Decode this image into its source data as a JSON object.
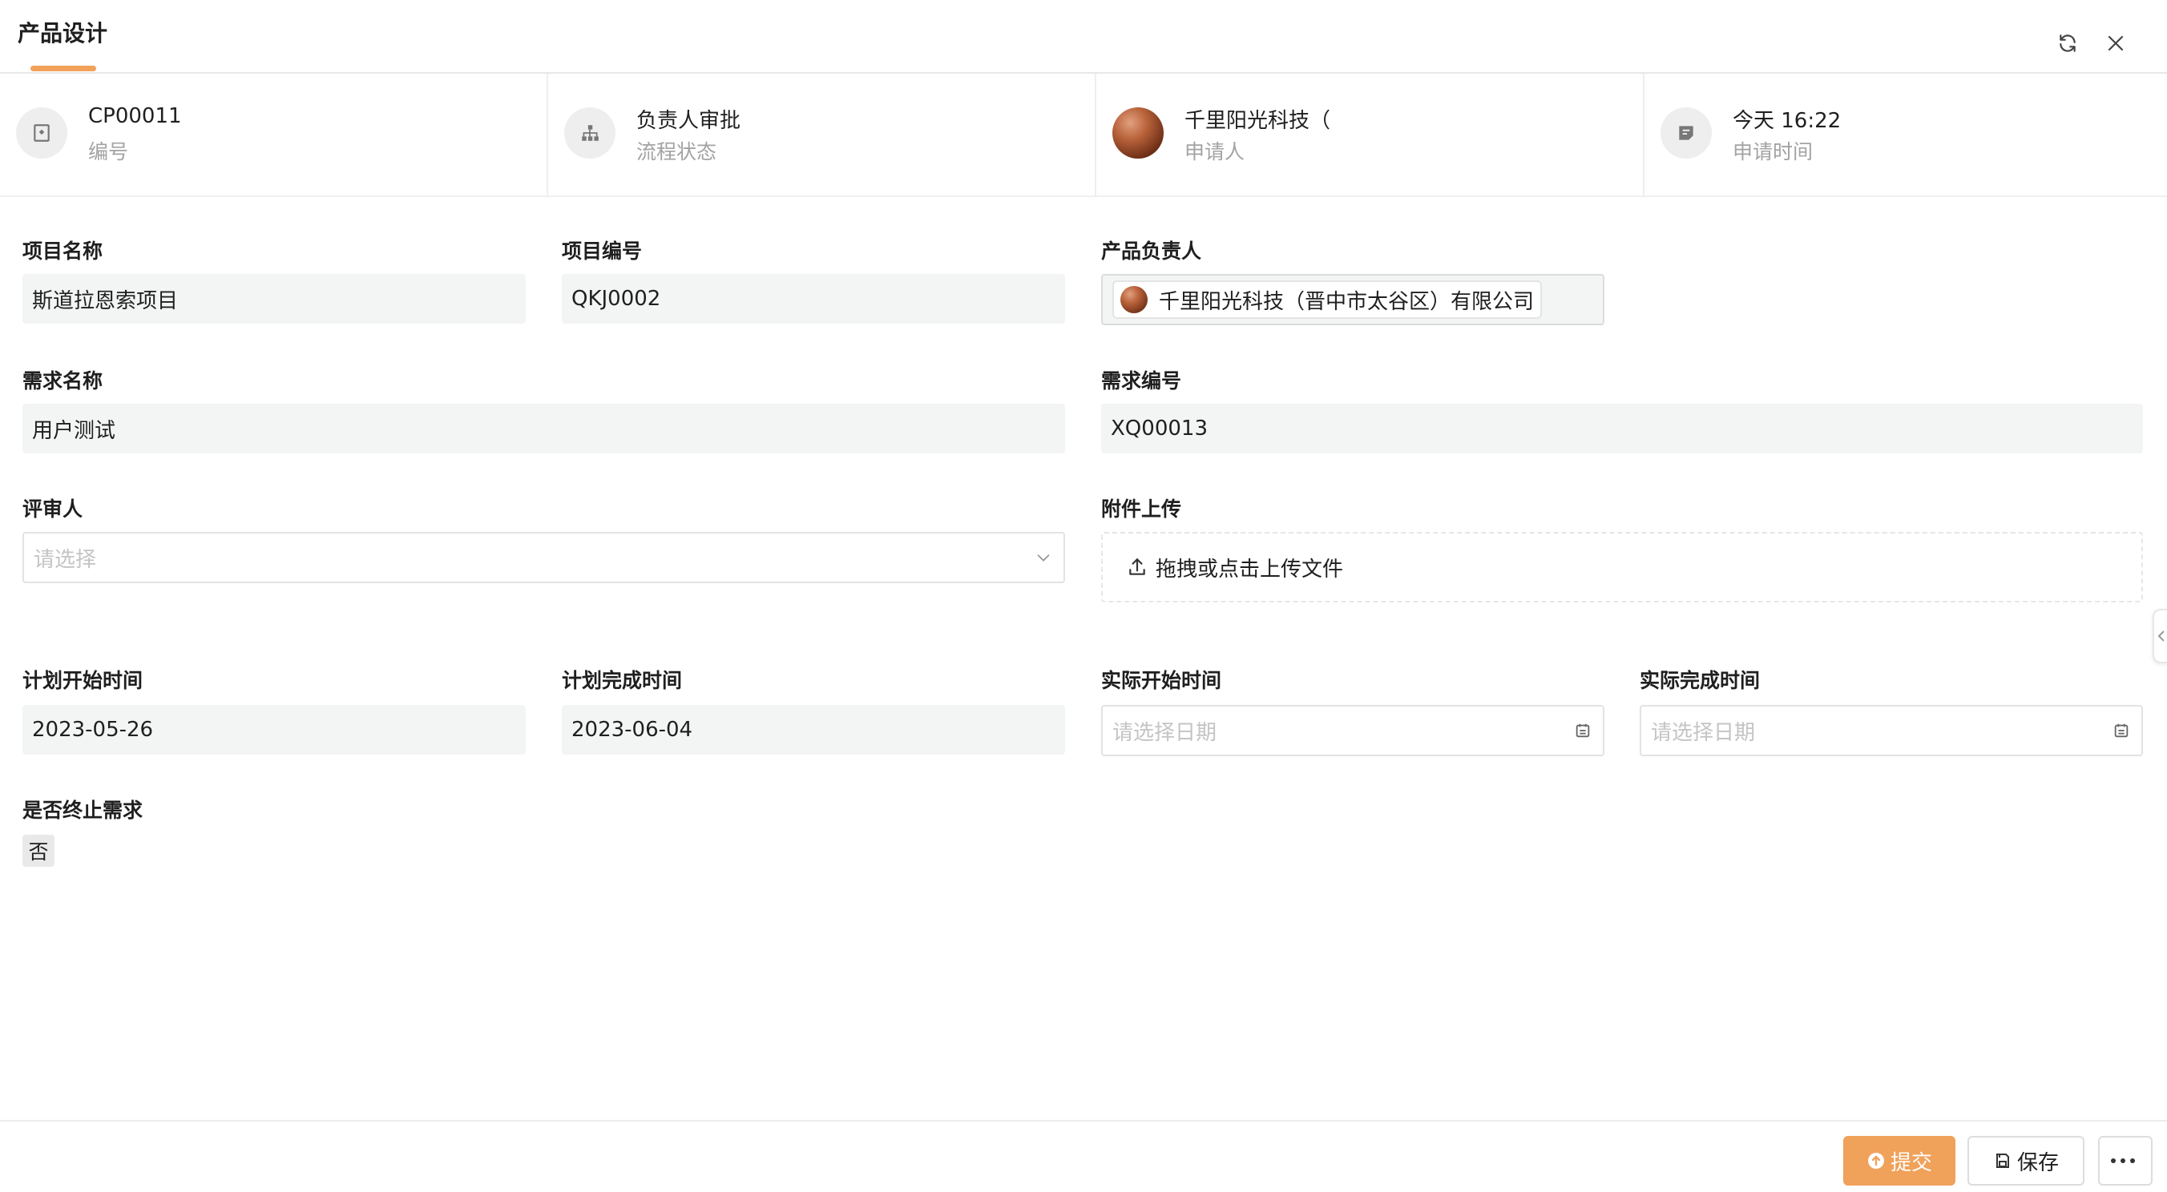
{
  "header": {
    "title": "产品设计"
  },
  "info": [
    {
      "value": "CP00011",
      "label": "编号",
      "icon": "badge-icon"
    },
    {
      "value": "负责人审批",
      "label": "流程状态",
      "icon": "org-chart-icon"
    },
    {
      "value": "千里阳光科技（",
      "label": "申请人",
      "icon": "avatar"
    },
    {
      "value": "今天 16:22",
      "label": "申请时间",
      "icon": "note-icon"
    }
  ],
  "form": {
    "project_name": {
      "label": "项目名称",
      "value": "斯道拉恩索项目"
    },
    "project_code": {
      "label": "项目编号",
      "value": "QKJ0002"
    },
    "product_owner": {
      "label": "产品负责人",
      "value": "千里阳光科技（晋中市太谷区）有限公司"
    },
    "req_name": {
      "label": "需求名称",
      "value": "用户测试"
    },
    "req_code": {
      "label": "需求编号",
      "value": "XQ00013"
    },
    "reviewer": {
      "label": "评审人",
      "placeholder": "请选择"
    },
    "attachment": {
      "label": "附件上传",
      "text": "拖拽或点击上传文件"
    },
    "plan_start": {
      "label": "计划开始时间",
      "value": "2023-05-26"
    },
    "plan_end": {
      "label": "计划完成时间",
      "value": "2023-06-04"
    },
    "actual_start": {
      "label": "实际开始时间",
      "placeholder": "请选择日期"
    },
    "actual_end": {
      "label": "实际完成时间",
      "placeholder": "请选择日期"
    },
    "terminate": {
      "label": "是否终止需求",
      "value": "否"
    }
  },
  "footer": {
    "submit_label": "提交",
    "save_label": "保存"
  },
  "colors": {
    "accent": "#f0a15a",
    "field_bg": "#f3f4f4",
    "placeholder": "#c4c4c4",
    "muted": "#a3a3a3"
  }
}
